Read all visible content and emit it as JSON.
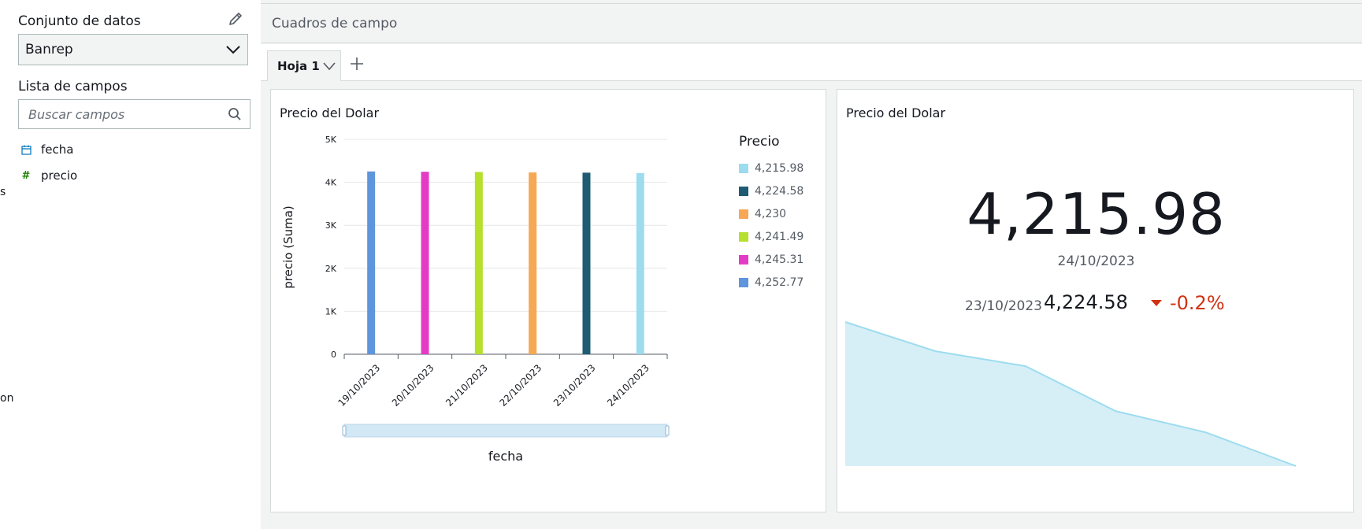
{
  "left_panel": {
    "edge_fragments": [
      "s",
      "on"
    ],
    "dataset_title": "Conjunto de datos",
    "dataset_selected": "Banrep",
    "fields_title": "Lista de campos",
    "search_placeholder": "Buscar campos",
    "fields": [
      {
        "label": "fecha",
        "type_icon": "calendar-icon",
        "color": "#0073bb"
      },
      {
        "label": "precio",
        "type_icon": "hash-icon",
        "color": "#1d8102"
      }
    ]
  },
  "workspace": {
    "header": "Cuadros de campo",
    "sheet_tab": "Hoja 1"
  },
  "bar_visual": {
    "title": "Precio del Dolar",
    "legend_title": "Precio",
    "legend": [
      {
        "label": "4,215.98",
        "color": "#9ddcef"
      },
      {
        "label": "4,224.58",
        "color": "#1f5c73"
      },
      {
        "label": "4,230",
        "color": "#f6a854"
      },
      {
        "label": "4,241.49",
        "color": "#b6e02b"
      },
      {
        "label": "4,245.31",
        "color": "#e43bc6"
      },
      {
        "label": "4,252.77",
        "color": "#5f95dc"
      }
    ]
  },
  "chart_data": {
    "type": "bar",
    "title": "Precio del Dolar",
    "xlabel": "fecha",
    "ylabel": "precio (Suma)",
    "ylim": [
      0,
      5000
    ],
    "yticks": [
      "0",
      "1K",
      "2K",
      "3K",
      "4K",
      "5K"
    ],
    "categories": [
      "19/10/2023",
      "20/10/2023",
      "21/10/2023",
      "22/10/2023",
      "23/10/2023",
      "24/10/2023"
    ],
    "values": [
      4252.77,
      4245.31,
      4241.49,
      4230,
      4224.58,
      4215.98
    ],
    "colors": [
      "#5f95dc",
      "#e43bc6",
      "#b6e02b",
      "#f6a854",
      "#1f5c73",
      "#9ddcef"
    ],
    "legend_title": "Precio",
    "legend_placement": "right",
    "grid": true
  },
  "kpi_visual": {
    "title": "Precio del Dolar",
    "value": "4,215.98",
    "date": "24/10/2023",
    "compare_date": "23/10/2023",
    "compare_value": "4,224.58",
    "delta": "-0.2%",
    "delta_color": "#d13212",
    "trend_values": [
      4252.77,
      4245.31,
      4241.49,
      4230,
      4224.58,
      4215.98
    ],
    "trend_color": "#9ddcef"
  }
}
